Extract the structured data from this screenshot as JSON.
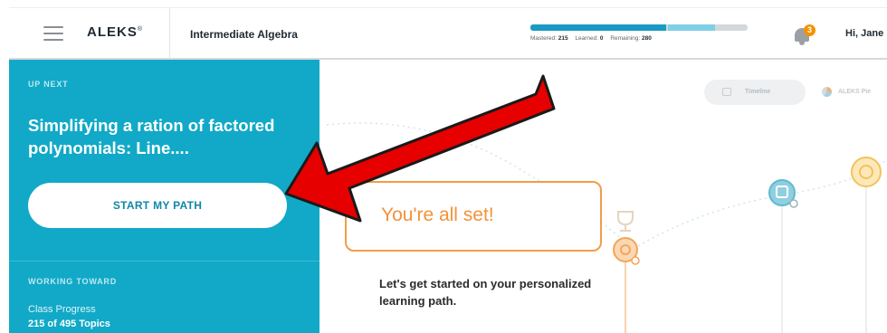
{
  "header": {
    "logo": "ALEKS",
    "logo_mark": "®",
    "course_title": "Intermediate Algebra",
    "progress": {
      "mastered_label": "Mastered:",
      "mastered": "215",
      "learned_label": "Learned:",
      "learned": "0",
      "remaining_label": "Remaining:",
      "remaining": "280",
      "mastered_fraction": 0.625,
      "learned_fraction": 0.0
    },
    "notifications": "3",
    "greeting": "Hi, Jane"
  },
  "sidebar": {
    "up_next_label": "UP NEXT",
    "topic_title": "Simplifying a ration of factored polynomials: Line....",
    "start_button": "START MY PATH",
    "working_toward_label": "WORKING TOWARD",
    "class_progress_label": "Class Progress",
    "class_progress_value": "215 of 495 Topics"
  },
  "main": {
    "toggle_timeline": "Timeline",
    "toggle_pie": "ALEKS Pie",
    "callout": "You're all set!",
    "intro": "Let's get started on your personalized learning path."
  },
  "colors": {
    "sidebar_bg": "#11a9c7",
    "accent_orange": "#f2923a",
    "progress_mastered": "#1a9bc4",
    "arrow_red": "#e60000"
  }
}
